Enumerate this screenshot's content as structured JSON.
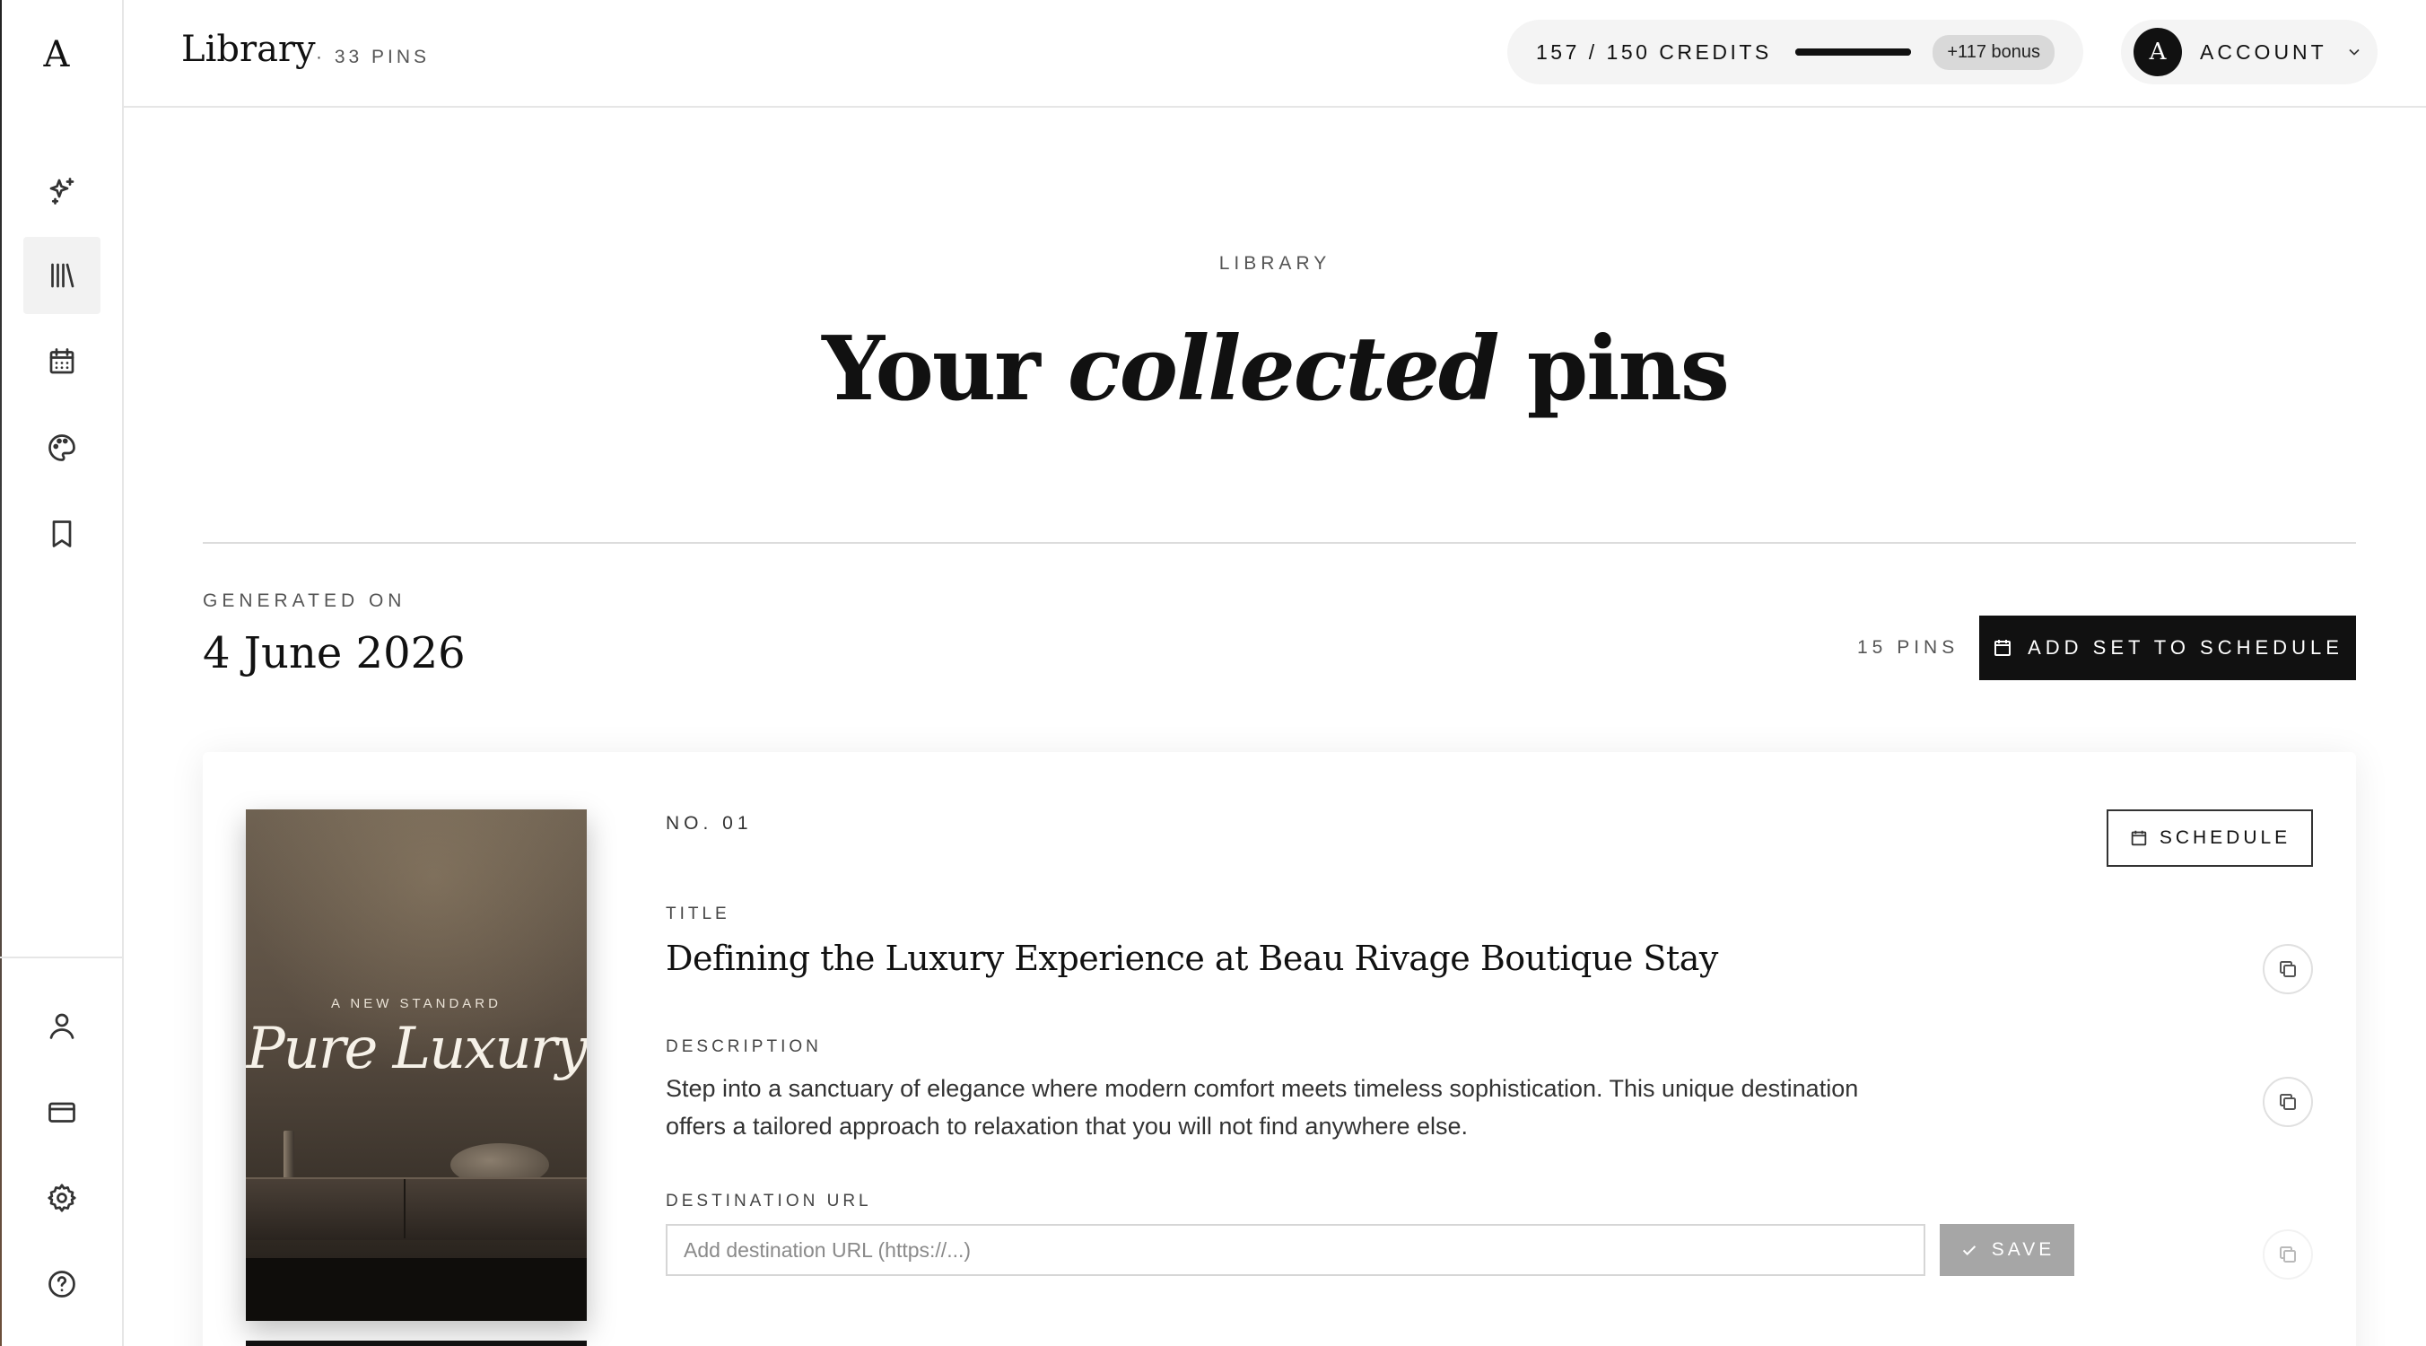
{
  "app": {
    "logo": "A"
  },
  "header": {
    "title": "Library",
    "count": "· 33 PINS",
    "credits": {
      "label": "157 / 150 CREDITS",
      "used": 157,
      "total": 150,
      "bonus": "+117 bonus"
    },
    "account": {
      "avatar": "A",
      "label": "ACCOUNT"
    }
  },
  "sidebar": {
    "items": [
      {
        "icon": "sparkles-icon",
        "label": "Generate"
      },
      {
        "icon": "library-icon",
        "label": "Library",
        "active": true
      },
      {
        "icon": "calendar-icon",
        "label": "Schedule"
      },
      {
        "icon": "palette-icon",
        "label": "Brand"
      },
      {
        "icon": "bookmark-icon",
        "label": "Saved"
      }
    ],
    "bottom": [
      {
        "icon": "user-icon"
      },
      {
        "icon": "credit-card-icon"
      },
      {
        "icon": "gear-icon"
      },
      {
        "icon": "help-icon"
      }
    ]
  },
  "hero": {
    "eyebrow": "LIBRARY",
    "title_before": "Your ",
    "title_em": "collected",
    "title_after": " pins"
  },
  "group": {
    "label": "GENERATED ON",
    "date": "4 June 2026",
    "count": "15 PINS",
    "schedule_set_label": "ADD SET TO SCHEDULE"
  },
  "pin": {
    "number": "NO. 01",
    "schedule_label": "SCHEDULE",
    "image": {
      "kicker": "A NEW STANDARD",
      "script": "Pure Luxury"
    },
    "title_label": "TITLE",
    "title": "Defining the Luxury Experience at Beau Rivage Boutique Stay",
    "description_label": "DESCRIPTION",
    "description": "Step into a sanctuary of elegance where modern comfort meets timeless sophistication. This unique destination offers a tailored approach to relaxation that you will not find anywhere else.",
    "url_label": "DESTINATION URL",
    "url_placeholder": "Add destination URL (https://...)",
    "url_value": "",
    "save_label": "SAVE"
  }
}
